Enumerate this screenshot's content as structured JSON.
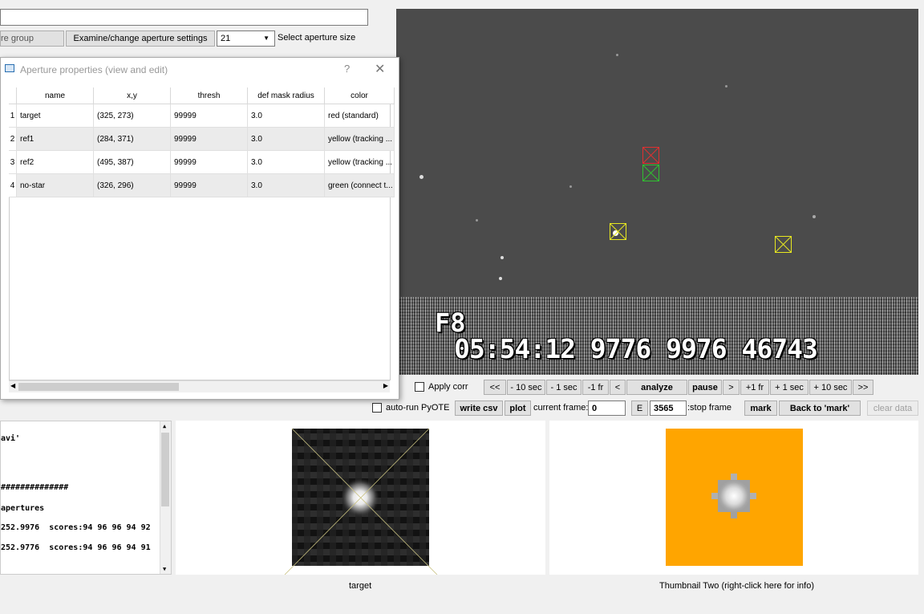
{
  "top_controls": {
    "path_field_value": "",
    "group_button_label": "re group",
    "examine_button_label": "Examine/change aperture settings",
    "aperture_size_value": "21",
    "aperture_size_label": "Select aperture size"
  },
  "dialog": {
    "title": "Aperture properties (view and edit)",
    "help": "?",
    "close": "✕",
    "columns": [
      "name",
      "x,y",
      "thresh",
      "def mask radius",
      "color"
    ],
    "rows": [
      {
        "num": "1",
        "name": "target",
        "xy": "(325, 273)",
        "thresh": "99999",
        "radius": "3.0",
        "color": "red (standard)"
      },
      {
        "num": "2",
        "name": "ref1",
        "xy": "(284, 371)",
        "thresh": "99999",
        "radius": "3.0",
        "color": "yellow (tracking ..."
      },
      {
        "num": "3",
        "name": "ref2",
        "xy": "(495, 387)",
        "thresh": "99999",
        "radius": "3.0",
        "color": "yellow (tracking ..."
      },
      {
        "num": "4",
        "name": "no-star",
        "xy": "(326, 296)",
        "thresh": "99999",
        "radius": "3.0",
        "color": "green (connect t..."
      }
    ]
  },
  "video": {
    "overlay_line1": "F8",
    "overlay_line2": "05:54:12 9776 9976 46743"
  },
  "playback": {
    "apply_corr_label": "Apply corr",
    "buttons": [
      "<<",
      "- 10 sec",
      "- 1 sec",
      "-1 fr",
      "<",
      "analyze",
      "pause",
      ">",
      "+1 fr",
      "+ 1 sec",
      "+ 10 sec",
      ">>"
    ]
  },
  "frame_row": {
    "auto_run_label": "auto-run PyOTE",
    "write_csv_label": "write csv",
    "plot_label": "plot",
    "current_frame_label": "current frame:",
    "current_frame_value": "0",
    "e_label": "E",
    "stop_frame_value": "3565",
    "stop_frame_label": ":stop frame",
    "mark_label": "mark",
    "back_to_mark_label": "Back to 'mark'",
    "clear_data_label": "clear data"
  },
  "log": {
    "lines": [
      "avi'",
      "",
      "##############",
      "apertures",
      "252.9976  scores:94 96 96 94 92",
      "252.9776  scores:94 96 96 94 91"
    ]
  },
  "thumbnails": {
    "one_caption": "target",
    "two_caption": "Thumbnail Two (right-click here for info)",
    "two_bg": "#ffa500"
  },
  "colors": {
    "target_aperture": "#e03030",
    "ref_aperture": "#e8e820",
    "nostar_aperture": "#30c030"
  }
}
